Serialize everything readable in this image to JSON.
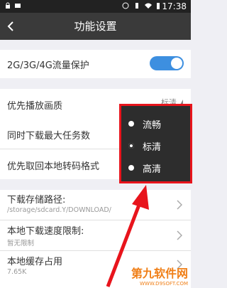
{
  "statusbar": {
    "time": "17:38"
  },
  "titlebar": {
    "title": "功能设置"
  },
  "settings": {
    "traffic_protect": "2G/3G/4G流量保护",
    "play_quality": "优先播放画质",
    "play_quality_value": "标清",
    "max_downloads": "同时下载最大任务数",
    "local_transcode": "优先取回本地转码格式",
    "download_path_label": "下载存储路径:",
    "download_path_value": "/storage/sdcard.Y/DOWNLOAD/",
    "speed_limit_label": "本地下载速度限制:",
    "speed_limit_value": "暂无限制",
    "cache_label": "本地缓存占用",
    "cache_value": "7.65K"
  },
  "quality_popup": {
    "options": [
      "流畅",
      "标清",
      "高清"
    ],
    "selected": "标清"
  },
  "colors": {
    "toggle_on": "#3d8fe0",
    "highlight": "#e8141c",
    "titlebar": "#3a3a3a"
  },
  "watermark": {
    "brand": "第九软件网",
    "url": "WWW.D9SOFT.COM"
  }
}
